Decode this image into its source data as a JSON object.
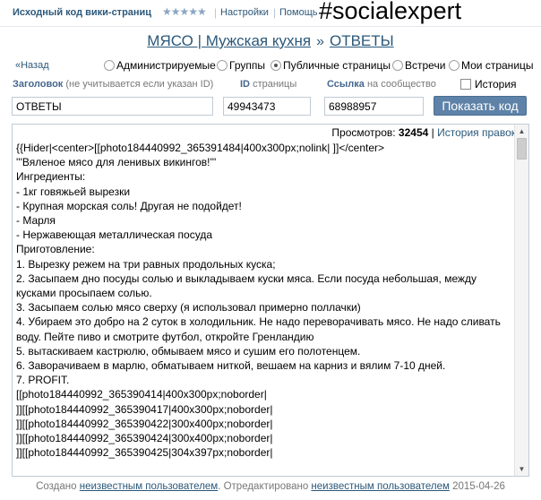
{
  "topbar": {
    "title": "Исходный код вики-страниц",
    "rating_stars": "★★★★★",
    "settings": "Настройки",
    "help": "Помощь",
    "hashtag": "#socialexpert"
  },
  "breadcrumb": {
    "group": "МЯСО | Мужская кухня",
    "arrow": "»",
    "page": "ОТВЕТЫ"
  },
  "filters": {
    "back": "«Назад",
    "options": [
      {
        "label": "Администрируемые",
        "selected": false
      },
      {
        "label": "Группы",
        "selected": false
      },
      {
        "label": "Публичные страницы",
        "selected": true
      },
      {
        "label": "Встречи",
        "selected": false
      },
      {
        "label": "Мои страницы",
        "selected": false
      }
    ]
  },
  "form": {
    "title_label": "Заголовок",
    "title_hint": "(не учитывается если указан ID)",
    "id_label": "ID",
    "id_hint": "страницы",
    "link_label": "Ссылка",
    "link_hint": "на сообщество",
    "history_checkbox": "История",
    "history_checked": false,
    "title_value": "ОТВЕТЫ",
    "id_value": "49943473",
    "link_value": "68988957",
    "submit": "Показать код"
  },
  "editor": {
    "views_label": "Просмотров:",
    "views_count": "32454",
    "history_link": "История правок",
    "lines": [
      "{{Hider|<center>[[photo184440992_365391484|400x300px;nolink| ]]</center>",
      "'''Вяленое мясо для ленивых викингов!'''",
      "Ингредиенты:",
      "- 1кг говяжьей вырезки",
      "- Крупная морская соль! Другая не подойдет!",
      "- Марля",
      "- Нержавеющая металлическая посуда",
      "Приготовление:",
      "1. Вырезку режем на три равных продольных куска;",
      "2. Засыпаем дно посуды солью и выкладываем куски мяса. Если посуда небольшая, между кусками просыпаем солью.",
      "3. Засыпаем солью мясо сверху (я использовал примерно поллачки)",
      "4. Убираем это добро на 2 суток в холодильник. Не надо переворачивать мясо. Не надо сливать воду. Пейте пиво и смотрите футбол, откройте Гренландию",
      "5. вытаскиваем кастрюлю, обмываем мясо и сушим его полотенцем.",
      "6. Заворачиваем в марлю, обматываем ниткой, вешаем на карниз и вялим 7-10 дней.",
      "7. PROFIT.",
      "[[photo184440992_365390414|400x300px;noborder|",
      "]][[photo184440992_365390417|400x300px;noborder|",
      "]][[photo184440992_365390422|300x400px;noborder|",
      "]][[photo184440992_365390424|300x400px;noborder|",
      "]][[photo184440992_365390425|304x397px;noborder|"
    ]
  },
  "footer": {
    "created": "Создано",
    "creator": "неизвестным пользователем",
    "edited": ". Отредактировано",
    "editor": "неизвестным пользователем",
    "date": "2015-04-26"
  }
}
